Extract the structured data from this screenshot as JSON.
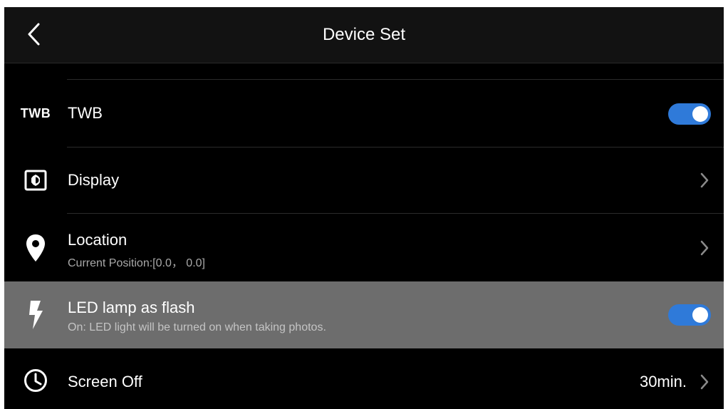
{
  "header": {
    "title": "Device Set"
  },
  "items": [
    {
      "id": "twb",
      "icon": "twb-text-icon",
      "icon_text": "TWB",
      "label": "TWB",
      "control": "toggle",
      "toggle_on": true
    },
    {
      "id": "display",
      "icon": "display-brightness-icon",
      "label": "Display",
      "control": "chevron"
    },
    {
      "id": "location",
      "icon": "location-pin-icon",
      "label": "Location",
      "sublabel": "Current Position:[0.0， 0.0]",
      "control": "chevron"
    },
    {
      "id": "led-flash",
      "icon": "lightning-bolt-icon",
      "label": "LED lamp as flash",
      "sublabel": "On: LED light will be turned on when taking photos.",
      "control": "toggle",
      "toggle_on": true,
      "highlighted": true
    },
    {
      "id": "screen-off",
      "icon": "clock-icon",
      "label": "Screen Off",
      "value": "30min.",
      "control": "chevron"
    }
  ],
  "colors": {
    "background": "#000000",
    "topbar": "#121212",
    "highlight_row": "#6d6d6d",
    "toggle_on": "#2f7ad9",
    "divider": "#2b2b2b"
  }
}
